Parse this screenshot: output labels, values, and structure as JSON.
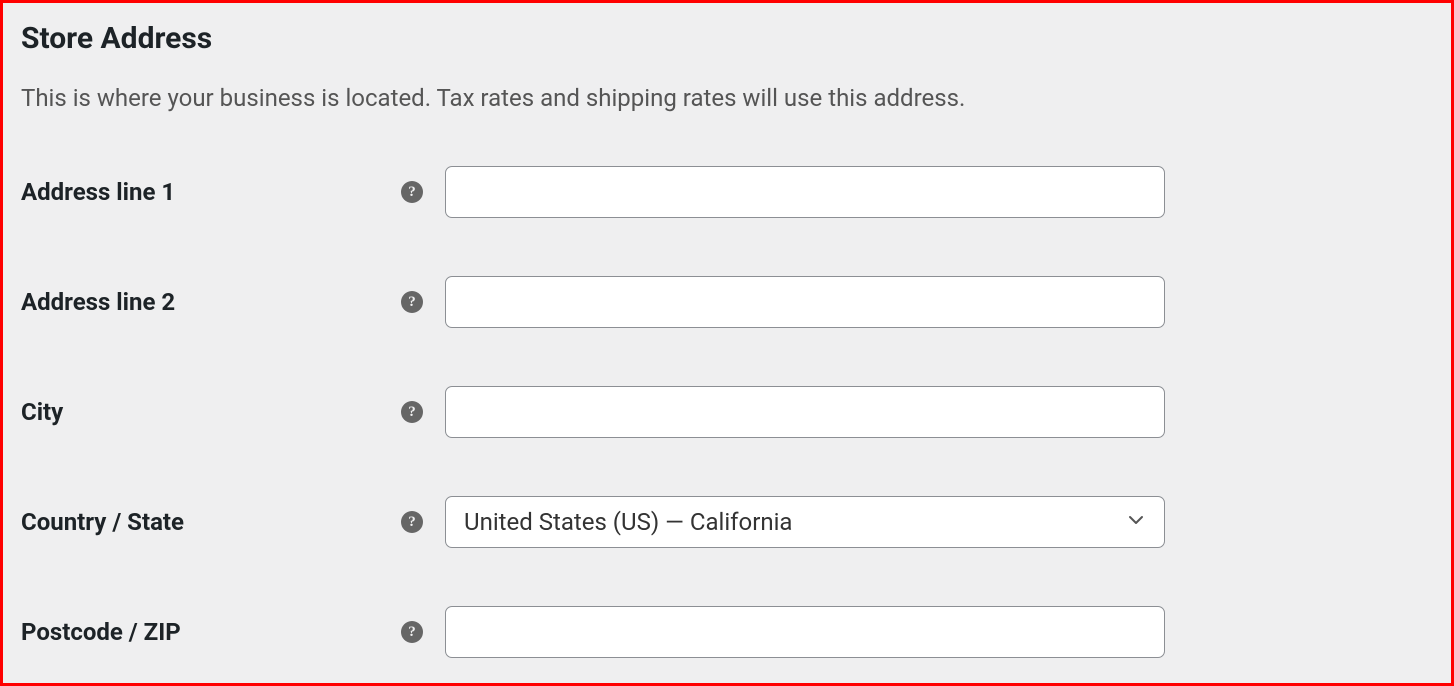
{
  "header": {
    "title": "Store Address",
    "description": "This is where your business is located. Tax rates and shipping rates will use this address."
  },
  "fields": {
    "address1": {
      "label": "Address line 1",
      "value": ""
    },
    "address2": {
      "label": "Address line 2",
      "value": ""
    },
    "city": {
      "label": "City",
      "value": ""
    },
    "country_state": {
      "label": "Country / State",
      "selected": "United States (US) — California"
    },
    "postcode": {
      "label": "Postcode / ZIP",
      "value": ""
    }
  },
  "icons": {
    "help": "?"
  }
}
